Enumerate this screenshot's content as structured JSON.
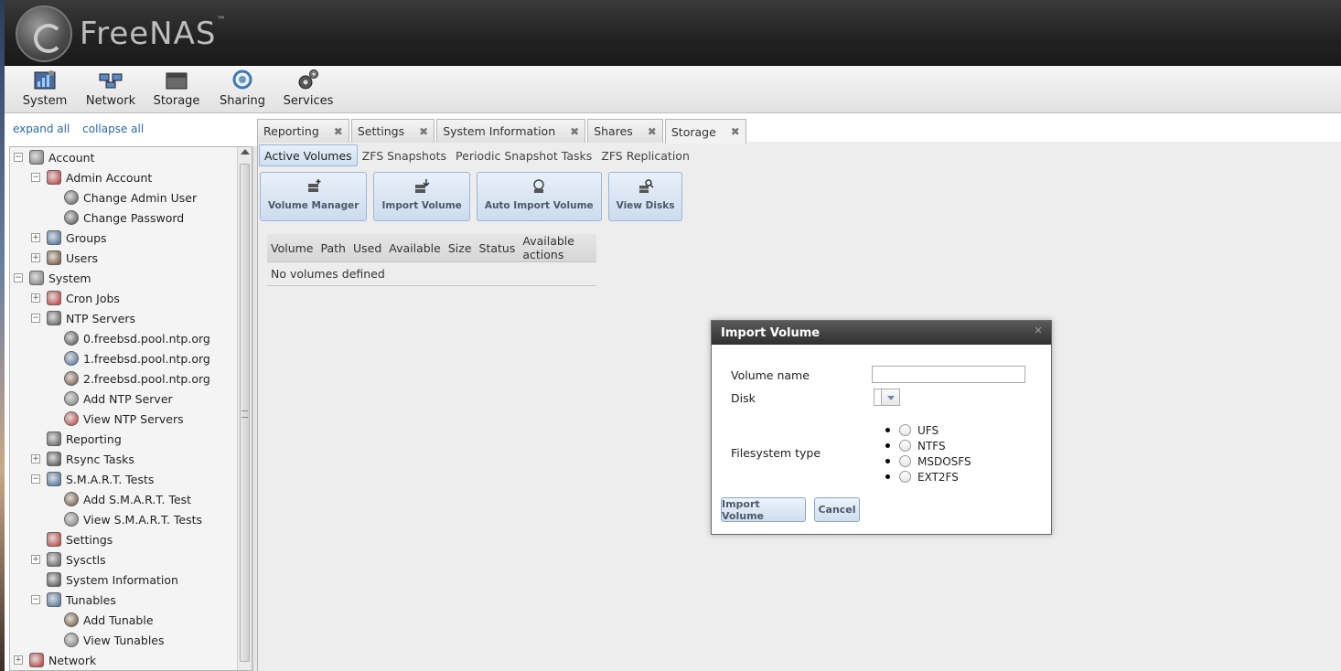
{
  "app": {
    "logo_text": "FreeNAS",
    "logo_tm": "™"
  },
  "nav": [
    {
      "label": "System",
      "icon": "system-icon"
    },
    {
      "label": "Network",
      "icon": "network-icon"
    },
    {
      "label": "Storage",
      "icon": "storage-icon"
    },
    {
      "label": "Sharing",
      "icon": "sharing-icon"
    },
    {
      "label": "Services",
      "icon": "services-icon"
    }
  ],
  "sidebar": {
    "expand_all": "expand all",
    "collapse_all": "collapse all",
    "items": [
      {
        "label": "Account",
        "level": 0,
        "toggle": "−"
      },
      {
        "label": "Admin Account",
        "level": 1,
        "toggle": "−"
      },
      {
        "label": "Change Admin User",
        "level": 2,
        "toggle": ""
      },
      {
        "label": "Change Password",
        "level": 2,
        "toggle": ""
      },
      {
        "label": "Groups",
        "level": 1,
        "toggle": "+"
      },
      {
        "label": "Users",
        "level": 1,
        "toggle": "+"
      },
      {
        "label": "System",
        "level": 0,
        "toggle": "−"
      },
      {
        "label": "Cron Jobs",
        "level": 1,
        "toggle": "+"
      },
      {
        "label": "NTP Servers",
        "level": 1,
        "toggle": "−"
      },
      {
        "label": "0.freebsd.pool.ntp.org",
        "level": 2,
        "toggle": ""
      },
      {
        "label": "1.freebsd.pool.ntp.org",
        "level": 2,
        "toggle": ""
      },
      {
        "label": "2.freebsd.pool.ntp.org",
        "level": 2,
        "toggle": ""
      },
      {
        "label": "Add NTP Server",
        "level": 2,
        "toggle": ""
      },
      {
        "label": "View NTP Servers",
        "level": 2,
        "toggle": ""
      },
      {
        "label": "Reporting",
        "level": 1,
        "toggle": ""
      },
      {
        "label": "Rsync Tasks",
        "level": 1,
        "toggle": "+"
      },
      {
        "label": "S.M.A.R.T. Tests",
        "level": 1,
        "toggle": "−"
      },
      {
        "label": "Add S.M.A.R.T. Test",
        "level": 2,
        "toggle": ""
      },
      {
        "label": "View S.M.A.R.T. Tests",
        "level": 2,
        "toggle": ""
      },
      {
        "label": "Settings",
        "level": 1,
        "toggle": ""
      },
      {
        "label": "Sysctls",
        "level": 1,
        "toggle": "+"
      },
      {
        "label": "System Information",
        "level": 1,
        "toggle": ""
      },
      {
        "label": "Tunables",
        "level": 1,
        "toggle": "−"
      },
      {
        "label": "Add Tunable",
        "level": 2,
        "toggle": ""
      },
      {
        "label": "View Tunables",
        "level": 2,
        "toggle": ""
      },
      {
        "label": "Network",
        "level": 0,
        "toggle": "+"
      }
    ]
  },
  "tabs": [
    {
      "label": "Reporting",
      "close": "✖"
    },
    {
      "label": "Settings",
      "close": "✖"
    },
    {
      "label": "System Information",
      "close": "✖"
    },
    {
      "label": "Shares",
      "close": "✖"
    },
    {
      "label": "Storage",
      "close": "✖"
    }
  ],
  "subtabs": [
    "Active Volumes",
    "ZFS Snapshots",
    "Periodic Snapshot Tasks",
    "ZFS Replication"
  ],
  "toolbar": [
    "Volume Manager",
    "Import Volume",
    "Auto Import Volume",
    "View Disks"
  ],
  "volumes_table": {
    "columns": [
      "Volume",
      "Path",
      "Used",
      "Available",
      "Size",
      "Status",
      "Available actions"
    ],
    "empty_text": "No volumes defined"
  },
  "dialog": {
    "title": "Import Volume",
    "close": "✕",
    "volume_name_label": "Volume name",
    "volume_name_value": "",
    "disk_label": "Disk",
    "fs_label": "Filesystem type",
    "fs_options": [
      "UFS",
      "NTFS",
      "MSDOSFS",
      "EXT2FS"
    ],
    "submit": "Import Volume",
    "cancel": "Cancel"
  }
}
